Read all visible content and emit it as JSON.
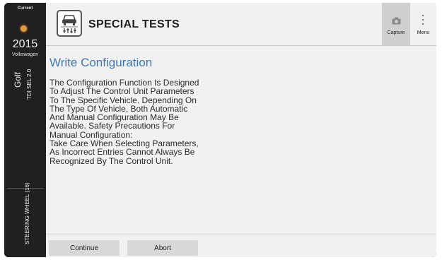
{
  "vehicle": {
    "status": "Current",
    "year": "2015",
    "make": "Volkswagen",
    "model": "Golf",
    "engine": "TDI SEL 2.0",
    "module": "STEERING WHEEL (16)",
    "status_dot_color": "#e49a3c"
  },
  "header": {
    "title": "SPECIAL TESTS",
    "icon": "car-diagnostics-icon",
    "capture_label": "Capture",
    "menu_label": "Menu"
  },
  "content": {
    "title": "Write Configuration",
    "body_lines": [
      "The Configuration Function Is Designed",
      "To Adjust The Control Unit Parameters",
      "To The Specific Vehicle. Depending On",
      "The Type Of Vehicle, Both Automatic",
      "And Manual Configuration May Be",
      "Available. Safety Precautions For",
      "Manual Configuration:",
      "Take Care When Selecting Parameters,",
      "As Incorrect Entries Cannot Always Be",
      "Recognized By The Control Unit."
    ]
  },
  "buttons": {
    "continue_label": "Continue",
    "abort_label": "Abort"
  },
  "colors": {
    "title_blue": "#3a79b8",
    "sidebar_bg": "#202020",
    "panel_bg": "#f1f1f1"
  }
}
